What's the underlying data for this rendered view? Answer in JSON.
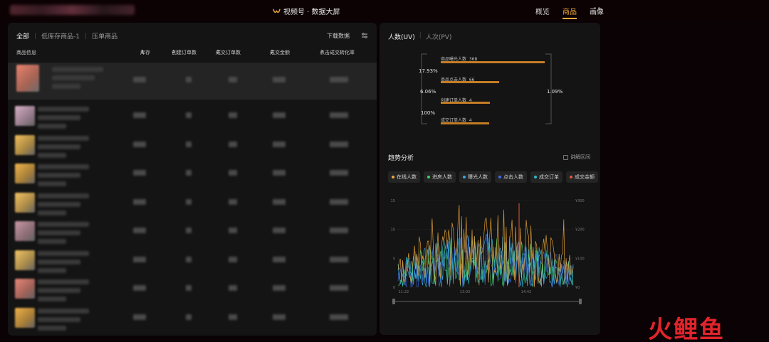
{
  "header": {
    "brand": "视频号 · 数据大屏",
    "nav": [
      "概览",
      "商品",
      "画像"
    ],
    "active_nav": "商品"
  },
  "left_panel": {
    "tabs": [
      "全部",
      "低库存商品-1",
      "压单商品"
    ],
    "download_label": "下载数据",
    "columns": [
      "商品信息",
      "库存",
      "创建订单数",
      "成交订单数",
      "成交金额",
      "点击成交转化率"
    ]
  },
  "right_panel": {
    "tabs": [
      "人数(UV)",
      "人次(PV)"
    ],
    "funnel": {
      "stages": [
        {
          "label": "商品曝光人数",
          "value": "368"
        },
        {
          "label": "商品点击人数",
          "value": "66"
        },
        {
          "label": "创建订单人数",
          "value": "4"
        },
        {
          "label": "成交订单人数",
          "value": "4"
        }
      ],
      "step_rates": [
        "17.93%",
        "6.06%",
        "100%"
      ],
      "overall_rate": "1.09%"
    },
    "trend": {
      "title": "趋势分析",
      "detail_label": "讲解区间",
      "legend": [
        {
          "name": "在线人数",
          "color": "#f0a93a"
        },
        {
          "name": "进房人数",
          "color": "#3fcf6a"
        },
        {
          "name": "曝光人数",
          "color": "#3aa7e6"
        },
        {
          "name": "点击人数",
          "color": "#3a6de6"
        },
        {
          "name": "成交订单",
          "color": "#2fb8c8"
        },
        {
          "name": "成交金额",
          "color": "#e05a3a"
        }
      ],
      "y_left_ticks": [
        "15",
        "10",
        "5",
        "0"
      ],
      "y_right_ticks": [
        "¥300",
        "¥200",
        "¥100",
        "¥0"
      ],
      "x_ticks": [
        "11:22",
        "13:03",
        "14:42"
      ]
    }
  },
  "watermark": {
    "part1": "火",
    "part2": "鲤鱼"
  }
}
